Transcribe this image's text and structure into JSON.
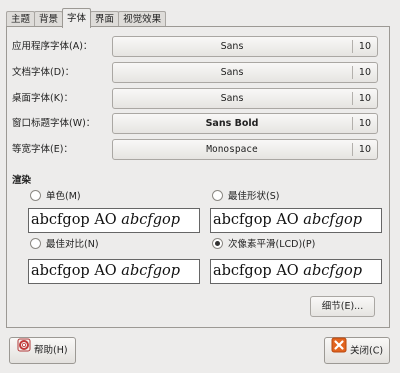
{
  "tabs": [
    "主题",
    "背景",
    "字体",
    "界面",
    "视觉效果"
  ],
  "fonts": [
    {
      "label": "应用程序字体(A)：",
      "font": "Sans",
      "size": "10"
    },
    {
      "label": "文档字体(D)：",
      "font": "Sans",
      "size": "10"
    },
    {
      "label": "桌面字体(K)：",
      "font": "Sans",
      "size": "10"
    },
    {
      "label": "窗口标题字体(W)：",
      "font": "Sans Bold",
      "size": "10"
    },
    {
      "label": "等宽字体(E)：",
      "font": "Monospace",
      "size": "10"
    }
  ],
  "rendering": {
    "title": "渲染",
    "options": [
      {
        "label": "单色(M)",
        "selected": false
      },
      {
        "label": "最佳形状(S)",
        "selected": false
      },
      {
        "label": "最佳对比(N)",
        "selected": false
      },
      {
        "label": "次像素平滑(LCD)(P)",
        "selected": true
      }
    ],
    "preview_text": "abcfgop AO",
    "preview_italic": "abcfgop"
  },
  "buttons": {
    "details": "细节(E)...",
    "help": "帮助(H)",
    "close": "关闭(C)"
  }
}
